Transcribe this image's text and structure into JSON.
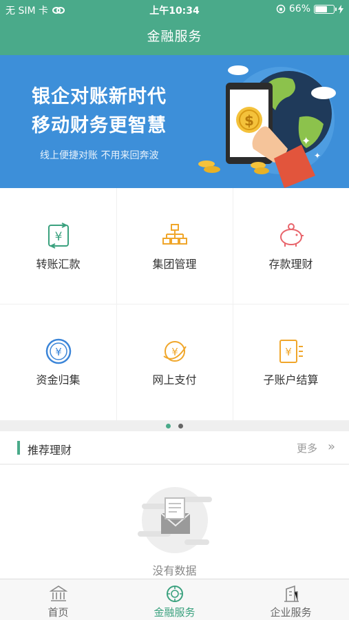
{
  "status_bar": {
    "carrier": "无 SIM 卡",
    "time": "上午10:34",
    "battery": "66%",
    "battery_level": 0.66
  },
  "nav": {
    "title": "金融服务"
  },
  "banner": {
    "headline1": "银企对账新时代",
    "headline2": "移动财务更智慧",
    "subline": "线上便捷对账  不用来回奔波",
    "coin_symbol": "$"
  },
  "services": [
    {
      "label": "转账汇款",
      "icon": "transfer-icon"
    },
    {
      "label": "集团管理",
      "icon": "org-chart-icon"
    },
    {
      "label": "存款理财",
      "icon": "piggy-bank-icon"
    },
    {
      "label": "资金归集",
      "icon": "yuan-coin-icon"
    },
    {
      "label": "网上支付",
      "icon": "online-pay-icon"
    },
    {
      "label": "子账户结算",
      "icon": "sub-account-icon"
    }
  ],
  "pager": {
    "pages": 2,
    "current": 1
  },
  "recommend": {
    "title": "推荐理财",
    "more": "更多",
    "more_arrows": "»"
  },
  "empty": {
    "message": "没有数据"
  },
  "tabs": [
    {
      "label": "首页",
      "icon": "bank-icon",
      "active": false
    },
    {
      "label": "金融服务",
      "icon": "finance-icon",
      "active": true
    },
    {
      "label": "企业服务",
      "icon": "building-icon",
      "active": false
    }
  ],
  "colors": {
    "primary": "#4aaa8a",
    "banner_bg": "#3d8fd9",
    "icon_green": "#3aa17e",
    "icon_orange": "#f0a62a",
    "icon_red": "#e8646b",
    "icon_blue": "#3b85d8"
  }
}
